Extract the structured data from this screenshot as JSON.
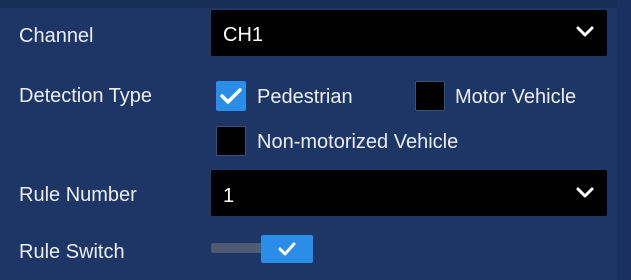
{
  "channel": {
    "label": "Channel",
    "value": "CH1"
  },
  "detection_type": {
    "label": "Detection Type",
    "options": [
      {
        "label": "Pedestrian",
        "checked": true
      },
      {
        "label": "Motor Vehicle",
        "checked": false
      },
      {
        "label": "Non-motorized Vehicle",
        "checked": false
      }
    ]
  },
  "rule_number": {
    "label": "Rule Number",
    "value": "1"
  },
  "rule_switch": {
    "label": "Rule Switch",
    "enabled": true
  },
  "colors": {
    "panel_bg": "#1e3665",
    "select_bg": "#000000",
    "accent": "#2a8ee8",
    "text": "#e9eef7"
  },
  "icons": {
    "dropdown": "chevron-down-icon",
    "check": "check-icon"
  }
}
